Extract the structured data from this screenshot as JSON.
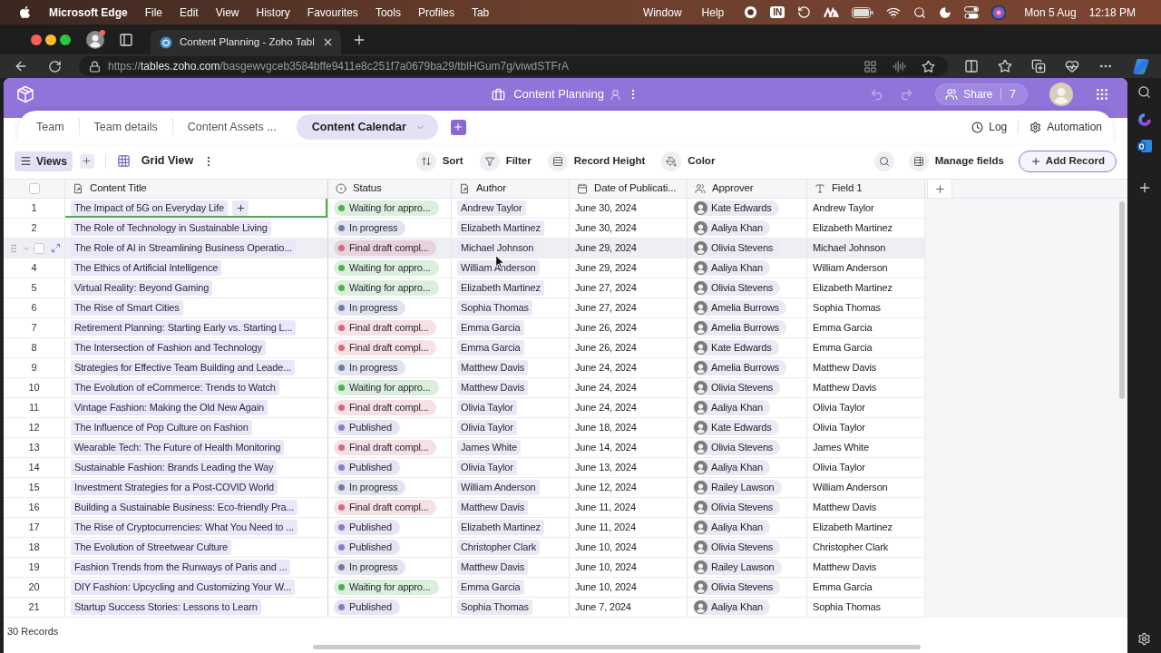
{
  "menu_bar": {
    "app": "Microsoft Edge",
    "menus": [
      "File",
      "Edit",
      "View",
      "History",
      "Favourites",
      "Tools",
      "Profiles",
      "Tab"
    ],
    "right_menus": [
      "Window",
      "Help"
    ],
    "input_source": "IN",
    "date": "Mon 5 Aug",
    "time": "12:18 PM"
  },
  "browser": {
    "tab_title": "Content Planning - Zoho Tabl",
    "url": {
      "scheme": "https://",
      "host": "tables.zoho.com",
      "path": "/basgewvgceb3584bffe9411e8c251f7a0679ba29/tblHGum7g/viwdSTFrA"
    }
  },
  "app_header": {
    "title": "Content Planning",
    "share_label": "Share",
    "share_count": "7"
  },
  "tabs": [
    {
      "label": "Team",
      "selected": false
    },
    {
      "label": "Team details",
      "selected": false
    },
    {
      "label": "Content Assets ...",
      "selected": false
    },
    {
      "label": "Content Calendar",
      "selected": true
    }
  ],
  "tab_actions": [
    {
      "label": "Log",
      "kind": "log"
    },
    {
      "label": "Automation",
      "kind": "automation"
    }
  ],
  "toolbar": {
    "views_label": "Views",
    "view_name": "Grid View",
    "actions": [
      {
        "label": "Sort",
        "kind": "sort"
      },
      {
        "label": "Filter",
        "kind": "filter"
      },
      {
        "label": "Record Height",
        "kind": "height"
      },
      {
        "label": "Color",
        "kind": "color"
      }
    ],
    "manage_fields": "Manage fields",
    "add_record": "Add Record"
  },
  "table": {
    "select_all_checked": false,
    "columns": [
      {
        "label": "Content Title",
        "kind": "title"
      },
      {
        "label": "Status",
        "kind": "status"
      },
      {
        "label": "Author",
        "kind": "link"
      },
      {
        "label": "Date of Publicati...",
        "kind": "date"
      },
      {
        "label": "Approver",
        "kind": "user"
      },
      {
        "label": "Field 1",
        "kind": "text"
      }
    ],
    "rows": [
      {
        "number": "1",
        "hovered": false,
        "checked": false,
        "focused": true,
        "cells": [
          "The Impact of 5G on Everyday Life",
          {
            "label": "Waiting for appro...",
            "color": "#4caf50"
          },
          "Andrew Taylor",
          "June 30, 2024",
          "Kate Edwards",
          "Andrew Taylor"
        ]
      },
      {
        "number": "2",
        "hovered": false,
        "checked": false,
        "focused": false,
        "cells": [
          "The Role of Technology in Sustainable Living",
          {
            "label": "In progress",
            "color": "#6f7ca8"
          },
          "Elizabeth Martinez",
          "June 30, 2024",
          "Aaliya Khan",
          "Elizabeth Martinez"
        ]
      },
      {
        "hovered": true,
        "checked": false,
        "focused": false,
        "cells": [
          "The Role of AI in Streamlining Business Operatio...",
          {
            "label": "Final draft compl...",
            "color": "#d26a7e"
          },
          "Michael Johnson",
          "June 29, 2024",
          "Olivia Stevens",
          "Michael Johnson"
        ]
      },
      {
        "number": "4",
        "hovered": false,
        "checked": false,
        "focused": false,
        "cells": [
          "The Ethics of Artificial Intelligence",
          {
            "label": "Waiting for appro...",
            "color": "#4caf50"
          },
          "William Anderson",
          "June 29, 2024",
          "Aaliya Khan",
          "William Anderson"
        ]
      },
      {
        "number": "5",
        "hovered": false,
        "checked": false,
        "focused": false,
        "cells": [
          "Virtual Reality: Beyond Gaming",
          {
            "label": "Waiting for appro...",
            "color": "#4caf50"
          },
          "Elizabeth Martinez",
          "June 27, 2024",
          "Olivia Stevens",
          "Elizabeth Martinez"
        ]
      },
      {
        "number": "6",
        "hovered": false,
        "checked": false,
        "focused": false,
        "cells": [
          "The Rise of Smart Cities",
          {
            "label": "In progress",
            "color": "#6f7ca8"
          },
          "Sophia Thomas",
          "June 27, 2024",
          "Amelia Burrows",
          "Sophia Thomas"
        ]
      },
      {
        "number": "7",
        "hovered": false,
        "checked": false,
        "focused": false,
        "cells": [
          "Retirement Planning: Starting Early vs. Starting L...",
          {
            "label": "Final draft compl...",
            "color": "#d26a7e"
          },
          "Emma Garcia",
          "June 26, 2024",
          "Amelia Burrows",
          "Emma Garcia"
        ]
      },
      {
        "number": "8",
        "hovered": false,
        "checked": false,
        "focused": false,
        "cells": [
          "The Intersection of Fashion and Technology",
          {
            "label": "Final draft compl...",
            "color": "#d26a7e"
          },
          "Emma Garcia",
          "June 26, 2024",
          "Kate Edwards",
          "Emma Garcia"
        ]
      },
      {
        "number": "9",
        "hovered": false,
        "checked": false,
        "focused": false,
        "cells": [
          "Strategies for Effective Team Building and Leade...",
          {
            "label": "In progress",
            "color": "#6f7ca8"
          },
          "Matthew Davis",
          "June 24, 2024",
          "Amelia Burrows",
          "Matthew Davis"
        ]
      },
      {
        "number": "10",
        "hovered": false,
        "checked": false,
        "focused": false,
        "cells": [
          "The Evolution of eCommerce: Trends to Watch",
          {
            "label": "Waiting for appro...",
            "color": "#4caf50"
          },
          "Matthew Davis",
          "June 24, 2024",
          "Olivia Stevens",
          "Matthew Davis"
        ]
      },
      {
        "number": "11",
        "hovered": false,
        "checked": false,
        "focused": false,
        "cells": [
          "Vintage Fashion: Making the Old New Again",
          {
            "label": "Final draft compl...",
            "color": "#d26a7e"
          },
          "Olivia Taylor",
          "June 24, 2024",
          "Aaliya Khan",
          "Olivia Taylor"
        ]
      },
      {
        "number": "12",
        "hovered": false,
        "checked": false,
        "focused": false,
        "cells": [
          "The Influence of Pop Culture on Fashion",
          {
            "label": "Published",
            "color": "#8c7ac8"
          },
          "Olivia Taylor",
          "June 18, 2024",
          "Kate Edwards",
          "Olivia Taylor"
        ]
      },
      {
        "number": "13",
        "hovered": false,
        "checked": false,
        "focused": false,
        "cells": [
          "Wearable Tech: The Future of Health Monitoring",
          {
            "label": "Final draft compl...",
            "color": "#d26a7e"
          },
          "James White",
          "June 14, 2024",
          "Olivia Stevens",
          "James White"
        ]
      },
      {
        "number": "14",
        "hovered": false,
        "checked": false,
        "focused": false,
        "cells": [
          "Sustainable Fashion: Brands Leading the Way",
          {
            "label": "Published",
            "color": "#8c7ac8"
          },
          "Olivia Taylor",
          "June 13, 2024",
          "Aaliya Khan",
          "Olivia Taylor"
        ]
      },
      {
        "number": "15",
        "hovered": false,
        "checked": false,
        "focused": false,
        "cells": [
          "Investment Strategies for a Post-COVID World",
          {
            "label": "In progress",
            "color": "#6f7ca8"
          },
          "William Anderson",
          "June 12, 2024",
          "Railey Lawson",
          "William Anderson"
        ]
      },
      {
        "number": "16",
        "hovered": false,
        "checked": false,
        "focused": false,
        "cells": [
          "Building a Sustainable Business: Eco-friendly Pra...",
          {
            "label": "Final draft compl...",
            "color": "#d26a7e"
          },
          "Matthew Davis",
          "June 11, 2024",
          "Olivia Stevens",
          "Matthew Davis"
        ]
      },
      {
        "number": "17",
        "hovered": false,
        "checked": false,
        "focused": false,
        "cells": [
          "The Rise of Cryptocurrencies: What You Need to ...",
          {
            "label": "Published",
            "color": "#8c7ac8"
          },
          "Elizabeth Martinez",
          "June 11, 2024",
          "Aaliya Khan",
          "Elizabeth Martinez"
        ]
      },
      {
        "number": "18",
        "hovered": false,
        "checked": false,
        "focused": false,
        "cells": [
          "The Evolution of Streetwear Culture",
          {
            "label": "Published",
            "color": "#8c7ac8"
          },
          "Christopher Clark",
          "June 10, 2024",
          "Olivia Stevens",
          "Christopher Clark"
        ]
      },
      {
        "number": "19",
        "hovered": false,
        "checked": false,
        "focused": false,
        "cells": [
          "Fashion Trends from the Runways of Paris and ...",
          {
            "label": "In progress",
            "color": "#6f7ca8"
          },
          "Matthew Davis",
          "June 10, 2024",
          "Railey Lawson",
          "Matthew Davis"
        ]
      },
      {
        "number": "20",
        "hovered": false,
        "checked": false,
        "focused": false,
        "cells": [
          "DIY Fashion: Upcycling and Customizing Your W...",
          {
            "label": "Waiting for appro...",
            "color": "#4caf50"
          },
          "Emma Garcia",
          "June 10, 2024",
          "Olivia Stevens",
          "Emma Garcia"
        ]
      },
      {
        "number": "21",
        "hovered": false,
        "checked": false,
        "focused": false,
        "cells": [
          "Startup Success Stories: Lessons to Learn",
          {
            "label": "Published",
            "color": "#8c7ac8"
          },
          "Sophia Thomas",
          "June 7, 2024",
          "Aaliya Khan",
          "Sophia Thomas"
        ]
      }
    ]
  },
  "footer": {
    "record_count": "30 Records"
  }
}
